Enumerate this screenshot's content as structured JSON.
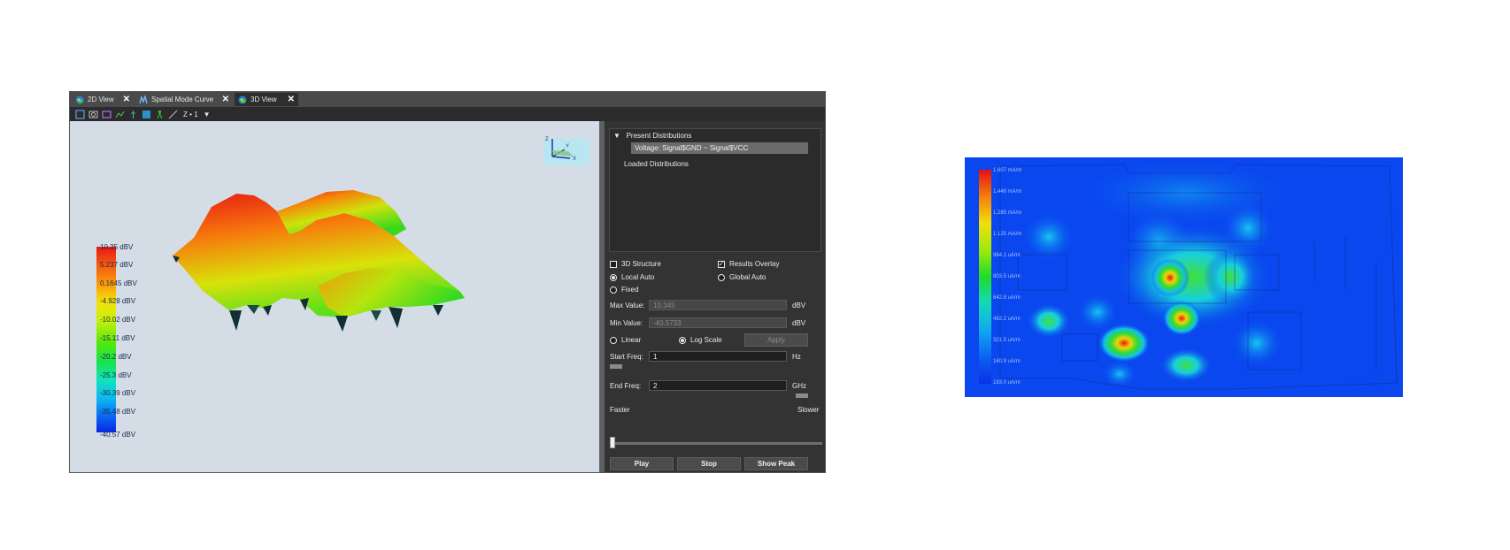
{
  "tabs": [
    {
      "label": "2D View",
      "active": false,
      "icon": "globe-icon"
    },
    {
      "label": "Spatial Mode Curve",
      "active": false,
      "icon": "curve-icon"
    },
    {
      "label": "3D View",
      "active": true,
      "icon": "globe-icon"
    }
  ],
  "toolbar": {
    "zoom_value": "Z • 1",
    "tools": [
      "select-icon",
      "rotate-icon",
      "box-icon",
      "curve-tool-icon",
      "probe-icon",
      "fill-icon",
      "person-icon",
      "measure-icon"
    ]
  },
  "viewport": {
    "colorbar_labels": [
      "10.35 dBV",
      "5.237 dBV",
      "0.1645 dBV",
      "-4.928 dBV",
      "-10.02 dBV",
      "-15.11 dBV",
      "-20.2 dBV",
      "-25.3 dBV",
      "-30.39 dBV",
      "-35.48 dBV",
      "-40.57 dBV"
    ],
    "axis_labels": {
      "z": "Z",
      "y": "Y",
      "x": "X"
    }
  },
  "panel": {
    "present_distributions": "Present Distributions",
    "selected_distribution": "Voltage: Signal$GND ~ Signal$VCC",
    "loaded_distributions": "Loaded Distributions",
    "structure_3d": {
      "label": "3D Structure",
      "checked": false
    },
    "results_overlay": {
      "label": "Results Overlay",
      "checked": true
    },
    "local_auto": {
      "label": "Local Auto",
      "selected": true
    },
    "global_auto": {
      "label": "Global Auto",
      "selected": false
    },
    "fixed": {
      "label": "Fixed",
      "selected": false
    },
    "max_value": {
      "label": "Max Value:",
      "value": "10.345",
      "unit": "dBV"
    },
    "min_value": {
      "label": "Min Value:",
      "value": "-40.5733",
      "unit": "dBV"
    },
    "linear": {
      "label": "Linear",
      "selected": false
    },
    "log_scale": {
      "label": "Log Scale",
      "selected": true
    },
    "apply_label": "Apply",
    "start_freq": {
      "label": "Start Freq:",
      "value": "1",
      "unit": "Hz"
    },
    "end_freq": {
      "label": "End Freq:",
      "value": "2",
      "unit": "GHz"
    },
    "faster_label": "Faster",
    "slower_label": "Slower",
    "speed_fraction": 0.0,
    "play_label": "Play",
    "stop_label": "Stop",
    "show_peak_label": "Show Peak"
  },
  "heatmap": {
    "scale_labels": [
      "1.607 mA/m",
      "1.446 mA/m",
      "1.285 mA/m",
      "1.125 mA/m",
      "964.1 uA/m",
      "803.5 uA/m",
      "642.8 uA/m",
      "482.2 uA/m",
      "321.5 uA/m",
      "160.9 uA/m",
      "183.0 uA/m"
    ]
  }
}
